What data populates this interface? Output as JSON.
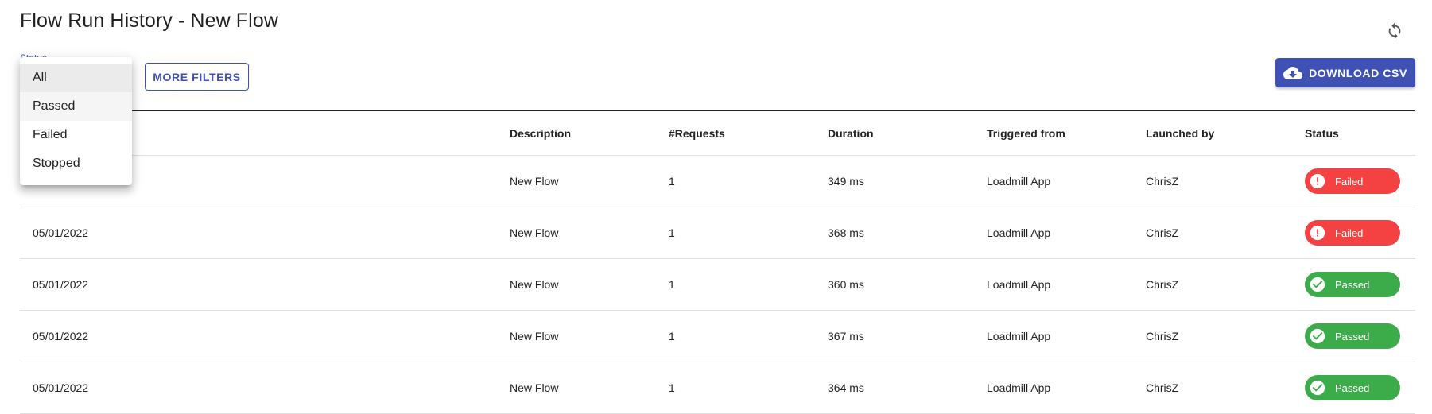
{
  "header": {
    "title": "Flow Run History - New Flow",
    "refresh_icon": "refresh-icon"
  },
  "filters": {
    "status_label": "Status",
    "more_filters_label": "MORE FILTERS",
    "download_label": "DOWNLOAD CSV",
    "download_icon": "cloud-download-icon",
    "status_options": [
      "All",
      "Passed",
      "Failed",
      "Stopped"
    ],
    "selected_option": "All"
  },
  "table": {
    "columns": [
      "",
      "Description",
      "#Requests",
      "Duration",
      "Triggered from",
      "Launched by",
      "Status"
    ],
    "rows": [
      {
        "date": "",
        "description": "New Flow",
        "requests": "1",
        "duration": "349 ms",
        "triggered_from": "Loadmill App",
        "launched_by": "ChrisZ",
        "status": "Failed"
      },
      {
        "date": "05/01/2022",
        "description": "New Flow",
        "requests": "1",
        "duration": "368 ms",
        "triggered_from": "Loadmill App",
        "launched_by": "ChrisZ",
        "status": "Failed"
      },
      {
        "date": "05/01/2022",
        "description": "New Flow",
        "requests": "1",
        "duration": "360 ms",
        "triggered_from": "Loadmill App",
        "launched_by": "ChrisZ",
        "status": "Passed"
      },
      {
        "date": "05/01/2022",
        "description": "New Flow",
        "requests": "1",
        "duration": "367 ms",
        "triggered_from": "Loadmill App",
        "launched_by": "ChrisZ",
        "status": "Passed"
      },
      {
        "date": "05/01/2022",
        "description": "New Flow",
        "requests": "1",
        "duration": "364 ms",
        "triggered_from": "Loadmill App",
        "launched_by": "ChrisZ",
        "status": "Passed"
      }
    ]
  },
  "colors": {
    "primary": "#3f51b5",
    "failed": "#f44242",
    "passed": "#3cac4a"
  }
}
